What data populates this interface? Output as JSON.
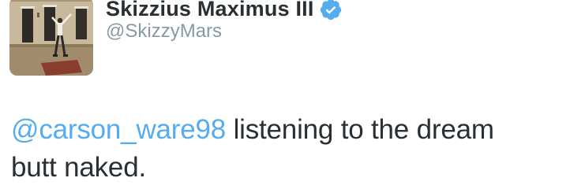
{
  "tweet": {
    "author": {
      "display_name": "Skizzius Maximus III",
      "username": "@SkizzyMars",
      "verified": true,
      "verified_icon": "verified-badge-icon",
      "avatar": "profile-photo"
    },
    "text": {
      "mention": "@carson_ware98",
      "line1_rest": " listening to the dream",
      "line2": "butt naked."
    }
  },
  "colors": {
    "mention": "#55acee",
    "verified_badge": "#55acee",
    "username": "#8899a6",
    "text": "#292f33"
  }
}
